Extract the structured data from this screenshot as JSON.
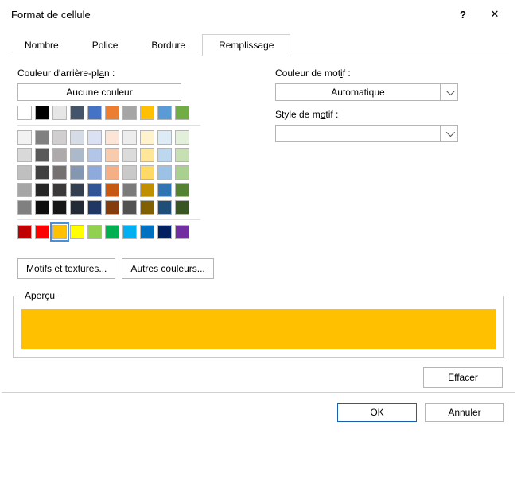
{
  "title": "Format de cellule",
  "titlebar_buttons": {
    "help": "?",
    "close": "✕"
  },
  "tabs": [
    {
      "label": "Nombre"
    },
    {
      "label": "Police"
    },
    {
      "label": "Bordure"
    },
    {
      "label": "Remplissage"
    }
  ],
  "left": {
    "label_prefix": "Couleur d'arrière-pl",
    "label_underline": "a",
    "label_suffix": "n :",
    "no_color": "Aucune couleur",
    "fill_effects_underline": "M",
    "fill_effects_rest": "otifs et textures...",
    "more_colors_underline": "A",
    "more_colors_rest": "utres couleurs..."
  },
  "colors": {
    "row1": [
      "#ffffff",
      "#000000",
      "#e7e6e6",
      "#44546a",
      "#4472c4",
      "#ed7d31",
      "#a5a5a5",
      "#ffc000",
      "#5b9bd5",
      "#70ad47"
    ],
    "rows2to6": [
      [
        "#f2f2f2",
        "#808080",
        "#d0cece",
        "#d6dce5",
        "#d9e1f2",
        "#fce4d6",
        "#ededed",
        "#fff2cc",
        "#ddebf7",
        "#e2efda"
      ],
      [
        "#d9d9d9",
        "#595959",
        "#aeaaaa",
        "#acb9ca",
        "#b4c6e7",
        "#f8cbad",
        "#dbdbdb",
        "#ffe699",
        "#bdd7ee",
        "#c6e0b4"
      ],
      [
        "#bfbfbf",
        "#404040",
        "#757171",
        "#8497b0",
        "#8ea9db",
        "#f4b084",
        "#c9c9c9",
        "#ffd966",
        "#9bc2e6",
        "#a9d08e"
      ],
      [
        "#a6a6a6",
        "#262626",
        "#3a3838",
        "#333f4f",
        "#305496",
        "#c65911",
        "#7b7b7b",
        "#bf8f00",
        "#2f75b5",
        "#548235"
      ],
      [
        "#808080",
        "#0d0d0d",
        "#161616",
        "#222b35",
        "#203764",
        "#833c0c",
        "#525252",
        "#806000",
        "#1f4e78",
        "#375623"
      ]
    ],
    "standard": [
      "#c00000",
      "#ff0000",
      "#ffc000",
      "#ffff00",
      "#92d050",
      "#00b050",
      "#00b0f0",
      "#0070c0",
      "#002060",
      "#7030a0"
    ],
    "selected_index_in_standard": 2
  },
  "right": {
    "pattern_color_prefix": "Couleur de mot",
    "pattern_color_underline": "i",
    "pattern_color_suffix": "f :",
    "pattern_color_value": "Automatique",
    "pattern_style_prefix": "Style de m",
    "pattern_style_underline": "o",
    "pattern_style_suffix": "tif :",
    "pattern_style_value": ""
  },
  "preview": {
    "legend": "Aperçu",
    "color": "#ffc000",
    "clear_underline": "E",
    "clear_rest": "ffacer"
  },
  "bottom": {
    "ok": "OK",
    "cancel": "Annuler"
  }
}
